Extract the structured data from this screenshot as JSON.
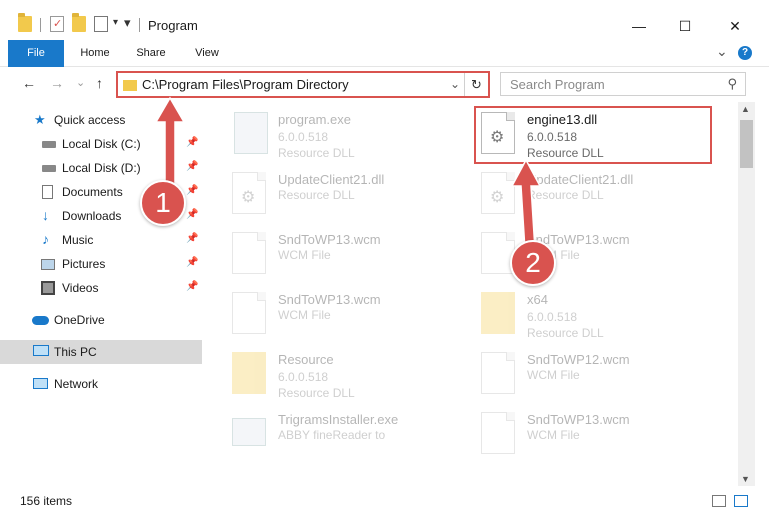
{
  "window": {
    "title": "Program",
    "minimize_glyph": "—",
    "maximize_glyph": "☐",
    "close_glyph": "✕"
  },
  "ribbon": {
    "tabs": [
      "File",
      "Home",
      "Share",
      "View"
    ],
    "expand_glyph": "⌄",
    "help_glyph": "?"
  },
  "address": {
    "back_glyph": "←",
    "forward_glyph": "→",
    "recent_glyph": "⌄",
    "up_glyph": "↑",
    "path": "C:\\Program Files\\Program Directory",
    "dropdown_glyph": "⌄",
    "refresh_glyph": "↻"
  },
  "search": {
    "placeholder": "Search Program",
    "icon_glyph": "⚲"
  },
  "sidebar": {
    "items": [
      {
        "label": "Quick access",
        "icon": "star-icon",
        "pinned": false
      },
      {
        "label": "Local Disk (C:)",
        "icon": "drive-icon",
        "pinned": true
      },
      {
        "label": "Local Disk (D:)",
        "icon": "drive-icon",
        "pinned": true
      },
      {
        "label": "Documents",
        "icon": "document-icon",
        "pinned": true
      },
      {
        "label": "Downloads",
        "icon": "download-icon",
        "pinned": true
      },
      {
        "label": "Music",
        "icon": "music-icon",
        "pinned": true
      },
      {
        "label": "Pictures",
        "icon": "picture-icon",
        "pinned": true
      },
      {
        "label": "Videos",
        "icon": "video-icon",
        "pinned": true
      },
      {
        "label": "OneDrive",
        "icon": "cloud-icon",
        "pinned": false
      },
      {
        "label": "This PC",
        "icon": "computer-icon",
        "pinned": false,
        "selected": true
      },
      {
        "label": "Network",
        "icon": "network-icon",
        "pinned": false
      }
    ],
    "pin_glyph": "📌"
  },
  "files": [
    {
      "name": "program.exe",
      "version": "6.0.0.518",
      "type": "Resource DLL",
      "icon": "exe-icon"
    },
    {
      "name": "engine13.dll",
      "version": "6.0.0.518",
      "type": "Resource DLL",
      "icon": "dll-icon",
      "highlighted": true
    },
    {
      "name": "UpdateClient21.dll",
      "version": "",
      "type": "Resource DLL",
      "icon": "dll-icon"
    },
    {
      "name": "UpdateClient21.dll",
      "version": "",
      "type": "Resource DLL",
      "icon": "dll-icon"
    },
    {
      "name": "SndToWP13.wcm",
      "version": "",
      "type": "WCM File",
      "icon": "file-icon"
    },
    {
      "name": "SndToWP13.wcm",
      "version": "",
      "type": "WCM File",
      "icon": "file-icon"
    },
    {
      "name": "SndToWP13.wcm",
      "version": "",
      "type": "WCM File",
      "icon": "file-icon"
    },
    {
      "name": "x64",
      "version": "6.0.0.518",
      "type": "Resource DLL",
      "icon": "folder-icon"
    },
    {
      "name": "Resource",
      "version": "6.0.0.518",
      "type": "Resource DLL",
      "icon": "folder-icon"
    },
    {
      "name": "SndToWP12.wcm",
      "version": "",
      "type": "WCM File",
      "icon": "file-icon"
    },
    {
      "name": "TrigramsInstaller.exe",
      "version": "",
      "type": "ABBY fineReader to",
      "icon": "exe-icon"
    },
    {
      "name": "SndToWP13.wcm",
      "version": "",
      "type": "WCM File",
      "icon": "file-icon"
    }
  ],
  "status": {
    "item_count": "156 items"
  },
  "callouts": [
    "1",
    "2"
  ],
  "colors": {
    "accent": "#1979ca",
    "highlight": "#d9534f",
    "selected_bg": "#d9d9d9"
  }
}
